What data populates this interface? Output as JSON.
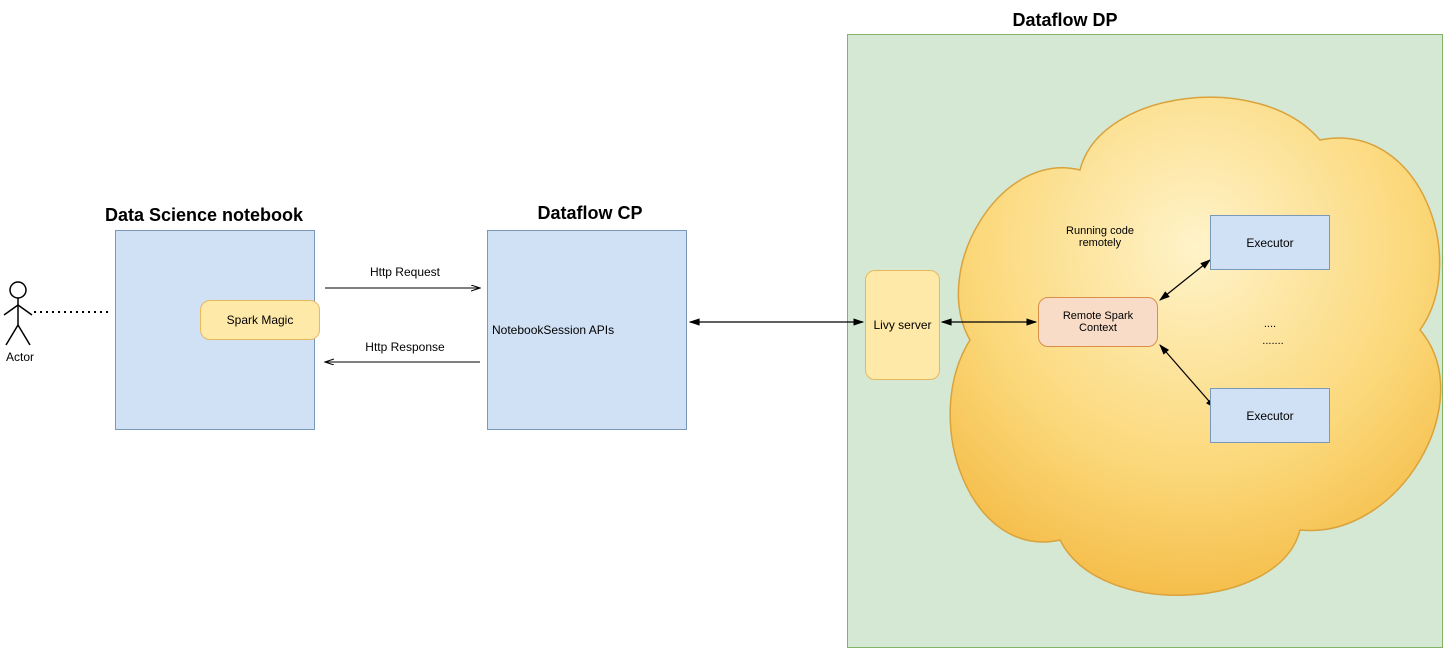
{
  "actor": {
    "label": "Actor"
  },
  "headings": {
    "notebook": "Data Science notebook",
    "dataflow_cp": "Dataflow CP",
    "dataflow_dp": "Dataflow DP"
  },
  "boxes": {
    "spark_magic": "Spark Magic",
    "notebook_session_apis": "NotebookSession APIs",
    "livy_server": "Livy server",
    "remote_spark_context": "Remote Spark Context",
    "executor1": "Executor",
    "executor2": "Executor"
  },
  "labels": {
    "http_request": "Http Request",
    "http_response": "Http Response",
    "running_remotely": "Running code remotely",
    "dots1": "....",
    "dots2": "......."
  }
}
